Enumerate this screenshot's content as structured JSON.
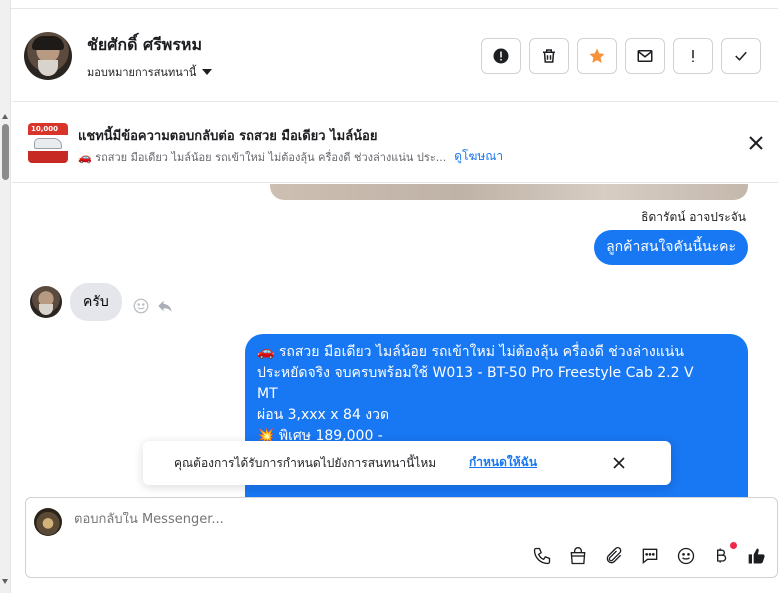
{
  "header": {
    "contact_name": "ชัยศักดิ์ ศรีพรหม",
    "assign_label": "มอบหมายการสนทนานี้",
    "actions": [
      {
        "name": "report-icon"
      },
      {
        "name": "trash-icon"
      },
      {
        "name": "star-icon"
      },
      {
        "name": "mail-icon"
      },
      {
        "name": "exclamation-icon"
      },
      {
        "name": "check-icon"
      }
    ]
  },
  "ad_bar": {
    "title": "แชทนี้มีข้อความตอบกลับต่อ รถสวย มือเดียว ไมล์น้อย",
    "subtitle": "🚗 รถสวย มือเดียว ไมล์น้อย รถเข้าใหม่ ไม่ต้องลุ้น ครื่องดี ช่วงล่างแน่น ประ...",
    "link": "ดูโฆษณา",
    "thumb_price": "10,000"
  },
  "chat": {
    "sender_name": "ธิดารัตน์ อาจประจัน",
    "msg_out_1": "ลูกค้าสนใจคันนี้นะคะ",
    "msg_in_1": "ครับ",
    "msg_out_2_line1": "🚗 รถสวย มือเดียว ไมล์น้อย รถเข้าใหม่ ไม่ต้องลุ้น ครื่องดี ช่วงล่างแน่น",
    "msg_out_2_line2": "ประหยัดจริง จบครบพร้อมใช้  W013 - BT-50 Pro Freestyle Cab 2.2 V",
    "msg_out_2_line3": "MT",
    "msg_out_2_line4": "ผ่อน 3,xxx x 84 งวด",
    "msg_out_2_line5": "💥 พิเศษ 189,000 -"
  },
  "toast": {
    "text": "คุณต้องการได้รับการกำหนดไปยังการสนทนานี้ไหม",
    "link": "กำหนดให้ฉัน"
  },
  "composer": {
    "placeholder": "ตอบกลับใน Messenger..."
  },
  "colors": {
    "accent": "#1877f2",
    "star": "#f7923a",
    "bubble_in": "#e4e6eb",
    "notif": "#f02849"
  }
}
